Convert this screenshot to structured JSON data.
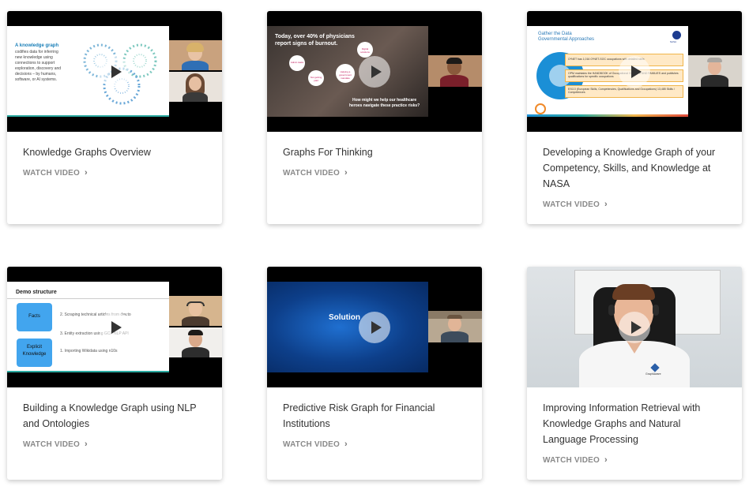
{
  "watch_label": "WATCH VIDEO",
  "chevron": "›",
  "cards": [
    {
      "title": "Knowledge Graphs Overview",
      "thumb_text": {
        "line1": "A knowledge graph",
        "line2": "codifies data for inferring",
        "line3": "new knowledge using",
        "line4": "connections to support",
        "line5": "exploration, discovery and",
        "line6": "decisions – by humans,",
        "line7": "software, or AI systems."
      }
    },
    {
      "title": "Graphs For Thinking",
      "thumb_text": {
        "headline1": "Today, over 40% of physicians",
        "headline2": "report signs of burnout.",
        "bubble1": "Admin tasks",
        "bubble2": "Not getting paid",
        "bubble3": "Helping a government mandate",
        "bubble4": "Digital solutions",
        "question1": "How might we help our healthcare",
        "question2": "heroes navigate these practice risks?"
      }
    },
    {
      "title": "Developing a Knowledge Graph of your Competency, Skills, and Knowledge at NASA",
      "thumb_text": {
        "heading1": "Gather the Data",
        "heading2": "Governmental Approaches",
        "row1": "O*NET has 1,016 O*NET-SOC occupations with detailed skills",
        "row2": "OPM maintains the HANDBOOK of Occupational GROUPS AND FAMILIES and publishes qualifications for specific occupations",
        "row3": "ESCO (European Skills, Competencies, Qualifications and Occupations) 13,485 Skills / Competences",
        "logo": "NASA"
      }
    },
    {
      "title": "Building a Knowledge Graph using NLP and Ontologies",
      "thumb_text": {
        "heading": "Demo structure",
        "box1": "Facts",
        "box2": "Explicit Knowledge",
        "step1": "2. Scraping technical articles from dev.to",
        "step2": "3. Entity extraction using GCP NLP API",
        "step3": "1. Importing Wikidata using n10s"
      }
    },
    {
      "title": "Predictive Risk Graph for Financial Institutions",
      "thumb_text": {
        "heading": "Solution"
      }
    },
    {
      "title": "Improving Information Retrieval with Knowledge Graphs and Natural Language Processing",
      "thumb_text": {
        "shirt_logo": "GraphAware"
      }
    }
  ]
}
